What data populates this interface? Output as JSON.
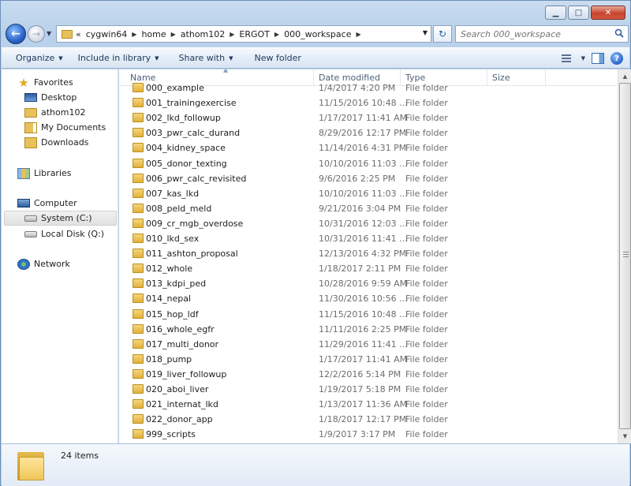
{
  "address": {
    "overflow": "«",
    "crumbs": [
      "cygwin64",
      "home",
      "athom102",
      "ERGOT",
      "000_workspace"
    ]
  },
  "search": {
    "placeholder": "Search 000_workspace"
  },
  "toolbar": {
    "organize": "Organize",
    "include": "Include in library",
    "share": "Share with",
    "new_folder": "New folder"
  },
  "nav": {
    "favorites": "Favorites",
    "desktop": "Desktop",
    "athom": "athom102",
    "documents": "My Documents",
    "downloads": "Downloads",
    "libraries": "Libraries",
    "computer": "Computer",
    "system": "System (C:)",
    "localdisk": "Local Disk (Q:)",
    "network": "Network"
  },
  "columns": {
    "name": "Name",
    "date": "Date modified",
    "type": "Type",
    "size": "Size"
  },
  "files": [
    {
      "name": "000_example",
      "date": "1/4/2017 4:20 PM",
      "type": "File folder"
    },
    {
      "name": "001_trainingexercise",
      "date": "11/15/2016 10:48 ...",
      "type": "File folder"
    },
    {
      "name": "002_lkd_followup",
      "date": "1/17/2017 11:41 AM",
      "type": "File folder"
    },
    {
      "name": "003_pwr_calc_durand",
      "date": "8/29/2016 12:17 PM",
      "type": "File folder"
    },
    {
      "name": "004_kidney_space",
      "date": "11/14/2016 4:31 PM",
      "type": "File folder"
    },
    {
      "name": "005_donor_texting",
      "date": "10/10/2016 11:03 ...",
      "type": "File folder"
    },
    {
      "name": "006_pwr_calc_revisited",
      "date": "9/6/2016 2:25 PM",
      "type": "File folder"
    },
    {
      "name": "007_kas_lkd",
      "date": "10/10/2016 11:03 ...",
      "type": "File folder"
    },
    {
      "name": "008_peld_meld",
      "date": "9/21/2016 3:04 PM",
      "type": "File folder"
    },
    {
      "name": "009_cr_mgb_overdose",
      "date": "10/31/2016 12:03 ...",
      "type": "File folder"
    },
    {
      "name": "010_lkd_sex",
      "date": "10/31/2016 11:41 ...",
      "type": "File folder"
    },
    {
      "name": "011_ashton_proposal",
      "date": "12/13/2016 4:32 PM",
      "type": "File folder"
    },
    {
      "name": "012_whole",
      "date": "1/18/2017 2:11 PM",
      "type": "File folder"
    },
    {
      "name": "013_kdpi_ped",
      "date": "10/28/2016 9:59 AM",
      "type": "File folder"
    },
    {
      "name": "014_nepal",
      "date": "11/30/2016 10:56 ...",
      "type": "File folder"
    },
    {
      "name": "015_hop_ldf",
      "date": "11/15/2016 10:48 ...",
      "type": "File folder"
    },
    {
      "name": "016_whole_egfr",
      "date": "11/11/2016 2:25 PM",
      "type": "File folder"
    },
    {
      "name": "017_multi_donor",
      "date": "11/29/2016 11:41 ...",
      "type": "File folder"
    },
    {
      "name": "018_pump",
      "date": "1/17/2017 11:41 AM",
      "type": "File folder"
    },
    {
      "name": "019_liver_followup",
      "date": "12/2/2016 5:14 PM",
      "type": "File folder"
    },
    {
      "name": "020_aboi_liver",
      "date": "1/19/2017 5:18 PM",
      "type": "File folder"
    },
    {
      "name": "021_internat_lkd",
      "date": "1/13/2017 11:36 AM",
      "type": "File folder"
    },
    {
      "name": "022_donor_app",
      "date": "1/18/2017 12:17 PM",
      "type": "File folder"
    },
    {
      "name": "999_scripts",
      "date": "1/9/2017 3:17 PM",
      "type": "File folder"
    }
  ],
  "status": {
    "count": "24 items"
  }
}
